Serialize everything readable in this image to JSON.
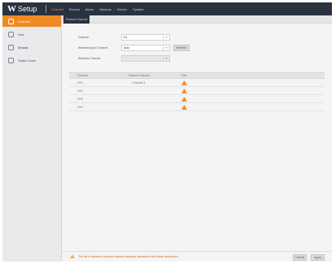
{
  "header": {
    "logo_mark": "W",
    "title": "Setup",
    "nav": [
      "Channel",
      "Record",
      "Alarm",
      "Network",
      "Device",
      "System"
    ],
    "active_nav": 0,
    "bg_color": "#2a3240",
    "accent_color": "#f08a24"
  },
  "sidebar": {
    "items": [
      {
        "label": "Channel",
        "icon": "camera-icon",
        "active": true
      },
      {
        "label": "Live",
        "icon": "monitor-icon",
        "active": false
      },
      {
        "label": "Mosaic",
        "icon": "grid-icon",
        "active": false
      },
      {
        "label": "Video Cover",
        "icon": "cover-icon",
        "active": false
      }
    ]
  },
  "tabs": [
    "Protocol Channel"
  ],
  "form": {
    "fields": [
      {
        "label": "Channel",
        "value": "D1"
      },
      {
        "label": "Wireless Input Channel",
        "value": "Auto",
        "button": "Refresh"
      },
      {
        "label": "Wireless Channel",
        "value": ""
      }
    ]
  },
  "table": {
    "headers": [
      "Channel",
      "Camera Channel",
      "Pair"
    ],
    "rows": [
      {
        "channel": "CH1",
        "camera": "Channel-1",
        "pair_icon": "warning-icon"
      },
      {
        "channel": "CH2",
        "camera": "",
        "pair_icon": "warning-icon"
      },
      {
        "channel": "CH3",
        "camera": "",
        "pair_icon": "warning-icon"
      },
      {
        "channel": "CH4",
        "camera": "",
        "pair_icon": "warning-icon"
      }
    ]
  },
  "footer": {
    "note": "The list of wireless cameras requires separate operations with these operations",
    "buttons": [
      "Cancel",
      "Apply"
    ]
  }
}
